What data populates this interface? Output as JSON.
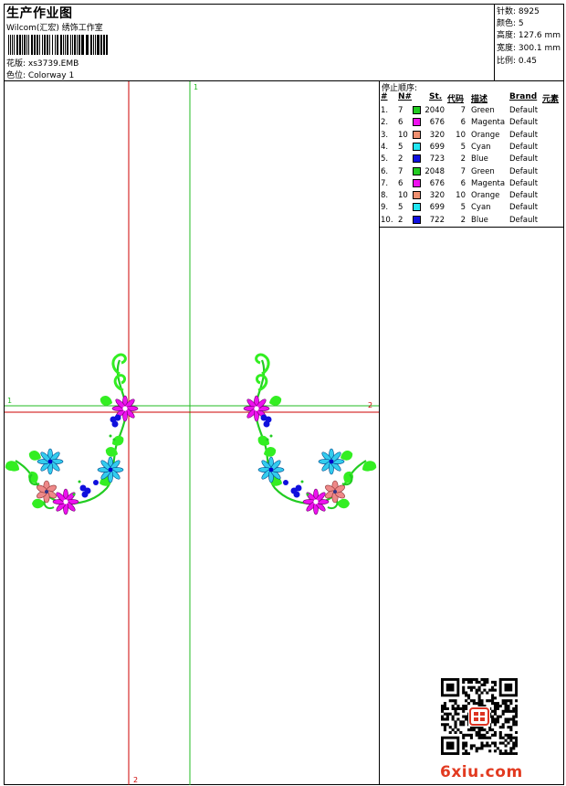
{
  "header": {
    "title": "生产作业图",
    "company": "Wilcom(汇宏) 绣饰工作室",
    "design_label": "花版: xs3739.EMB",
    "colorway_label": "色位: Colorway 1"
  },
  "stats": {
    "stitches": "针数: 8925",
    "colors": "颜色: 5",
    "height": "高度: 127.6 mm",
    "width": "宽度: 300.1 mm",
    "scale": "比例: 0.45"
  },
  "axes": {
    "v1_top": "1",
    "v2_bottom": "2",
    "h1_left": "1",
    "h2_right": "2"
  },
  "legend": {
    "title": "停止顺序:",
    "headers": [
      "#",
      "N#",
      "St.",
      "代码",
      "描述",
      "Brand",
      "元素"
    ],
    "rows": [
      {
        "idx": "1.",
        "n": "7",
        "color": "#22cc22",
        "st": "2040",
        "code": "7",
        "desc": "Green",
        "brand": "Default"
      },
      {
        "idx": "2.",
        "n": "6",
        "color": "#ee11ee",
        "st": "676",
        "code": "6",
        "desc": "Magenta",
        "brand": "Default"
      },
      {
        "idx": "3.",
        "n": "10",
        "color": "#f09070",
        "st": "320",
        "code": "10",
        "desc": "Orange",
        "brand": "Default"
      },
      {
        "idx": "4.",
        "n": "5",
        "color": "#22e6f2",
        "st": "699",
        "code": "5",
        "desc": "Cyan",
        "brand": "Default"
      },
      {
        "idx": "5.",
        "n": "2",
        "color": "#1010e0",
        "st": "723",
        "code": "2",
        "desc": "Blue",
        "brand": "Default"
      },
      {
        "idx": "6.",
        "n": "7",
        "color": "#22cc22",
        "st": "2048",
        "code": "7",
        "desc": "Green",
        "brand": "Default"
      },
      {
        "idx": "7.",
        "n": "6",
        "color": "#ee11ee",
        "st": "676",
        "code": "6",
        "desc": "Magenta",
        "brand": "Default"
      },
      {
        "idx": "8.",
        "n": "10",
        "color": "#f09070",
        "st": "320",
        "code": "10",
        "desc": "Orange",
        "brand": "Default"
      },
      {
        "idx": "9.",
        "n": "5",
        "color": "#22e6f2",
        "st": "699",
        "code": "5",
        "desc": "Cyan",
        "brand": "Default"
      },
      {
        "idx": "10.",
        "n": "2",
        "color": "#1010e0",
        "st": "722",
        "code": "2",
        "desc": "Blue",
        "brand": "Default"
      }
    ]
  },
  "colors": {
    "leaf": "#33ee22",
    "stem": "#22cc22",
    "magenta": "#ee11ee",
    "cyan": "#33ccee",
    "orange": "#ee8888",
    "blue": "#1010dd",
    "axis_red": "#cc0000",
    "axis_green": "#22bb22"
  },
  "icons": {
    "qr": "qr-code-icon",
    "stamp": "seal-stamp-icon"
  },
  "watermark": "6xiu.com"
}
